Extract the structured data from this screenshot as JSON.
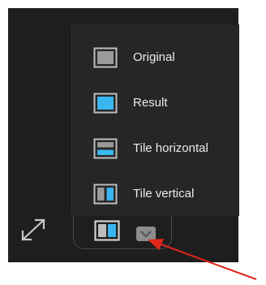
{
  "view_menu": {
    "items": [
      {
        "label": "Original",
        "icon": "original-view-icon"
      },
      {
        "label": "Result",
        "icon": "result-view-icon"
      },
      {
        "label": "Tile horizontal",
        "icon": "tile-horizontal-icon"
      },
      {
        "label": "Tile vertical",
        "icon": "tile-vertical-icon"
      }
    ]
  },
  "toolbar": {
    "expand_icon": "expand-arrows-icon",
    "view_toggle_icon": "tile-vertical-icon",
    "chevron_icon": "chevron-down-icon"
  },
  "annotation": {
    "arrow_color": "#e0261b"
  },
  "colors": {
    "background": "#1e1e1e",
    "menu_background": "#262626",
    "accent": "#39b5f0",
    "icon_gray": "#bdbdbd",
    "text": "#ececec"
  }
}
